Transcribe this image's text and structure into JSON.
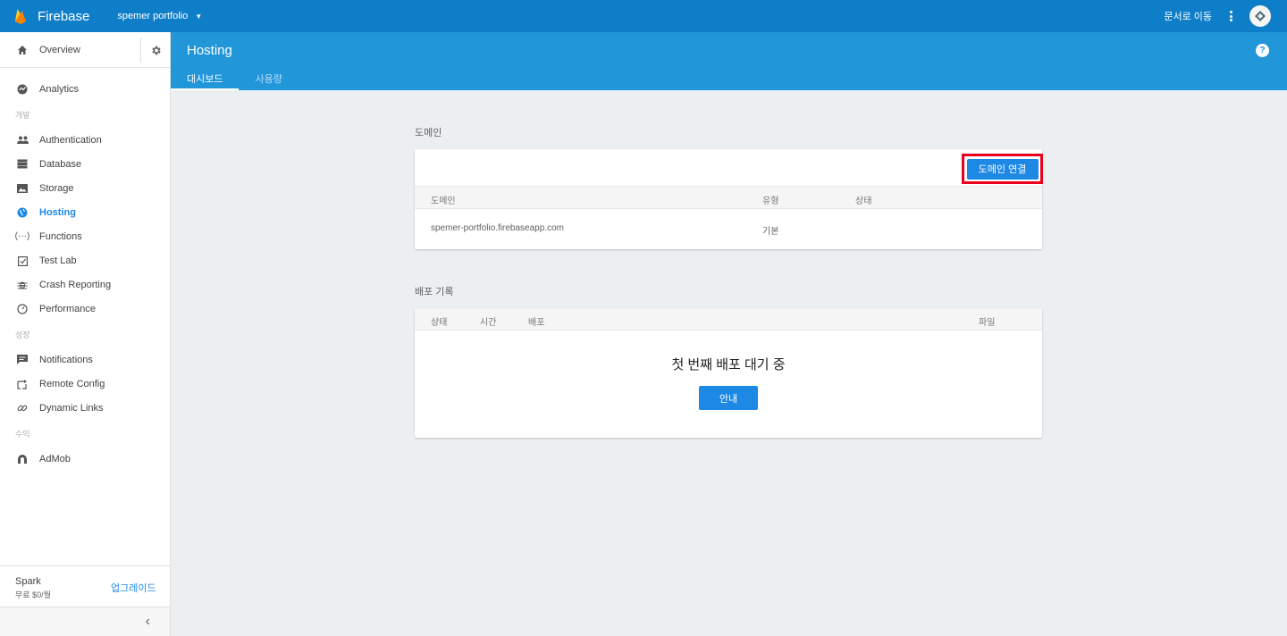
{
  "topbar": {
    "brand": "Firebase",
    "project": "spemer portfolio",
    "docs_link": "문서로 이동"
  },
  "sidebar": {
    "overview": "Overview",
    "analytics": "Analytics",
    "sections": {
      "develop": "개발",
      "grow": "성장",
      "earn": "수익"
    },
    "develop_items": [
      {
        "label": "Authentication",
        "icon": "people-icon"
      },
      {
        "label": "Database",
        "icon": "database-icon"
      },
      {
        "label": "Storage",
        "icon": "storage-icon"
      },
      {
        "label": "Hosting",
        "icon": "globe-icon",
        "active": true
      },
      {
        "label": "Functions",
        "icon": "functions-icon"
      },
      {
        "label": "Test Lab",
        "icon": "test-lab-icon"
      },
      {
        "label": "Crash Reporting",
        "icon": "bug-icon"
      },
      {
        "label": "Performance",
        "icon": "speedometer-icon"
      }
    ],
    "grow_items": [
      {
        "label": "Notifications",
        "icon": "message-icon"
      },
      {
        "label": "Remote Config",
        "icon": "remote-config-icon"
      },
      {
        "label": "Dynamic Links",
        "icon": "link-icon"
      }
    ],
    "earn_items": [
      {
        "label": "AdMob",
        "icon": "admob-icon"
      }
    ],
    "plan": {
      "name": "Spark",
      "price": "무료 $0/월",
      "upgrade": "업그레이드"
    }
  },
  "header": {
    "title": "Hosting",
    "tabs": [
      "대시보드",
      "사용량"
    ]
  },
  "domains": {
    "section_title": "도메인",
    "connect_button": "도메인 연결",
    "columns": [
      "도메인",
      "유형",
      "상태"
    ],
    "rows": [
      {
        "domain": "spemer-portfolio.firebaseapp.com",
        "type": "기본",
        "status": ""
      }
    ]
  },
  "deploys": {
    "section_title": "배포 기록",
    "columns": [
      "상태",
      "시간",
      "배포",
      "파일"
    ],
    "empty_text": "첫 번째 배포 대기 중",
    "guide_button": "안내"
  },
  "colors": {
    "topbar": "#0f7ec9",
    "header": "#2196d9",
    "accent": "#1e88e5",
    "highlight": "#e8001c"
  }
}
